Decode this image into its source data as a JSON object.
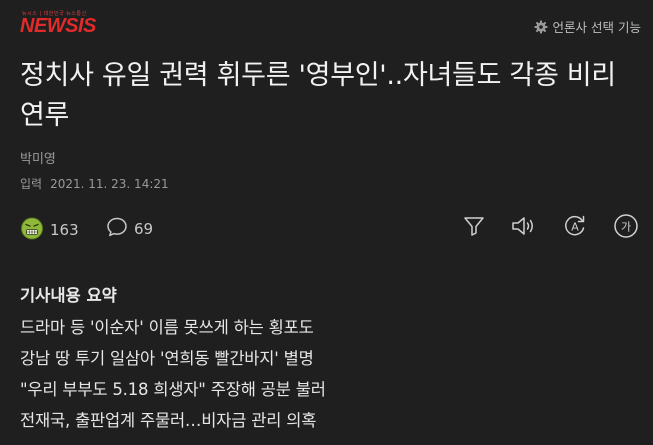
{
  "header": {
    "logo_tagline": "뉴시스 | 대한민국 뉴스통신",
    "logo_text": "NEWSIS",
    "press_select_label": "언론사 선택 기능",
    "press_select_icon": "gear-icon"
  },
  "article": {
    "headline": "정치사 유일 권력 휘두른 '영부인'..자녀들도 각종 비리 연루",
    "author": "박미영",
    "date_label": "입력",
    "date_value": "2021. 11. 23. 14:21"
  },
  "actions": {
    "reaction_icon": "angry-face-emoji-icon",
    "reaction_count": "163",
    "comment_icon": "speech-bubble-icon",
    "comment_count": "69",
    "tools": [
      "filter-icon",
      "speaker-icon",
      "translate-icon",
      "font-size-icon"
    ],
    "font_button_glyph": "가",
    "translate_glyph": "A"
  },
  "summary": {
    "title": "기사내용 요약",
    "lines": [
      "드라마 등 '이순자' 이름 못쓰게 하는 횡포도",
      "강남 땅 투기 일삼아 '연희동 빨간바지' 별명",
      "\"우리 부부도 5.18 희생자\" 주장해 공분 불러",
      "전재국, 출판업계 주물러…비자금 관리 의혹"
    ]
  },
  "colors": {
    "background": "#1f1f1f",
    "logo_red": "#e02b2b",
    "text_primary": "#f2f2f2",
    "text_muted": "#9a9a9a"
  }
}
